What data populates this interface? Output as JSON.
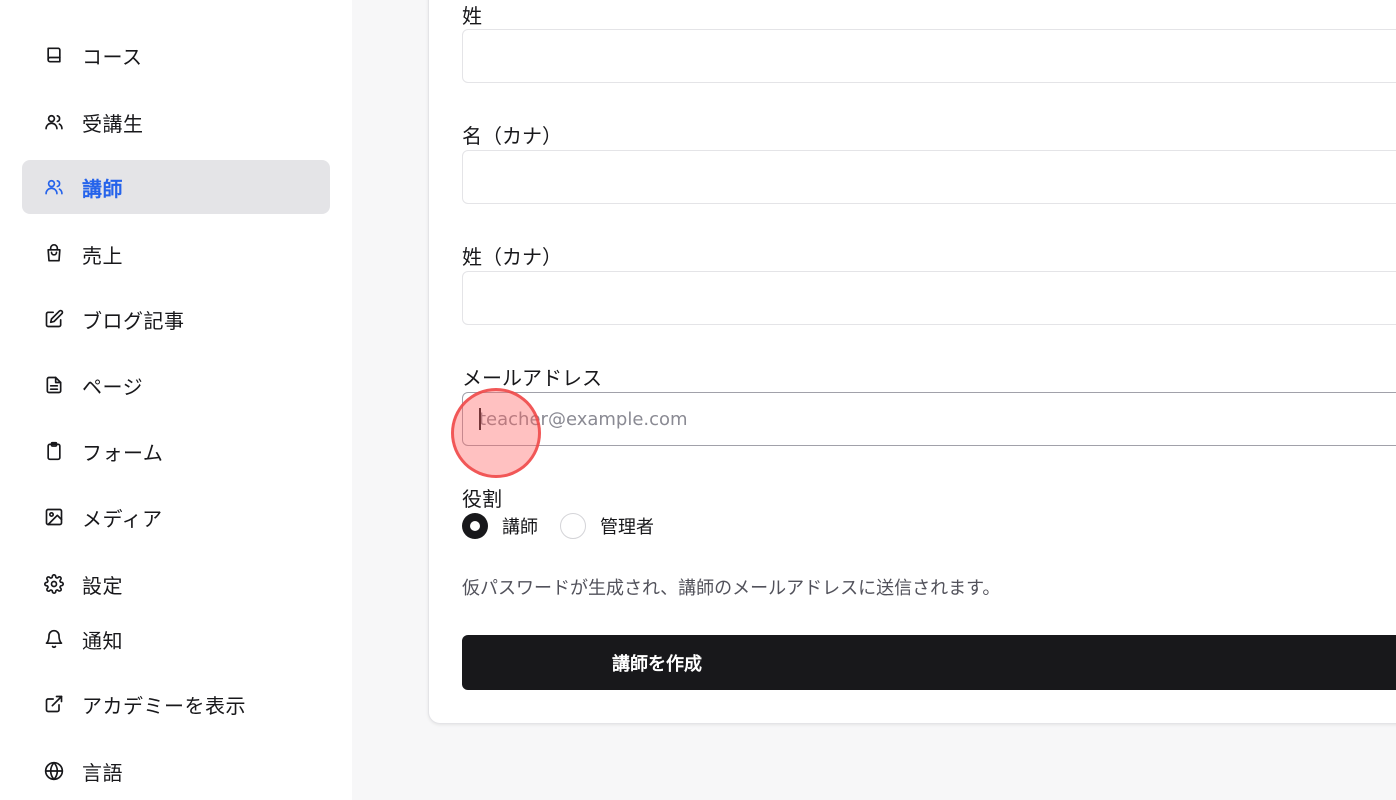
{
  "sidebar": {
    "items": [
      {
        "label": "コース",
        "icon": "book-icon"
      },
      {
        "label": "受講生",
        "icon": "users-icon"
      },
      {
        "label": "講師",
        "icon": "users-icon",
        "active": true
      },
      {
        "label": "売上",
        "icon": "shopping-bag-icon"
      },
      {
        "label": "ブログ記事",
        "icon": "edit-icon"
      },
      {
        "label": "ページ",
        "icon": "file-text-icon"
      },
      {
        "label": "フォーム",
        "icon": "clipboard-icon"
      },
      {
        "label": "メディア",
        "icon": "image-icon"
      },
      {
        "label": "設定",
        "icon": "gear-icon"
      },
      {
        "label": "通知",
        "icon": "bell-icon"
      },
      {
        "label": "アカデミーを表示",
        "icon": "external-link-icon"
      },
      {
        "label": "言語",
        "icon": "globe-icon"
      }
    ]
  },
  "form": {
    "last_name_label": "姓",
    "last_name_value": "",
    "first_name_kana_label": "名（カナ）",
    "first_name_kana_value": "",
    "last_name_kana_label": "姓（カナ）",
    "last_name_kana_value": "",
    "email_label": "メールアドレス",
    "email_placeholder": "teacher@example.com",
    "email_value": "",
    "role_label": "役割",
    "role_options": [
      {
        "label": "講師",
        "checked": true
      },
      {
        "label": "管理者",
        "checked": false
      }
    ],
    "helper_text": "仮パスワードが生成され、講師のメールアドレスに送信されます。",
    "submit_label": "講師を作成"
  },
  "colors": {
    "accent": "#2563eb",
    "button": "#18181b",
    "active_bg": "#e4e4e7"
  }
}
